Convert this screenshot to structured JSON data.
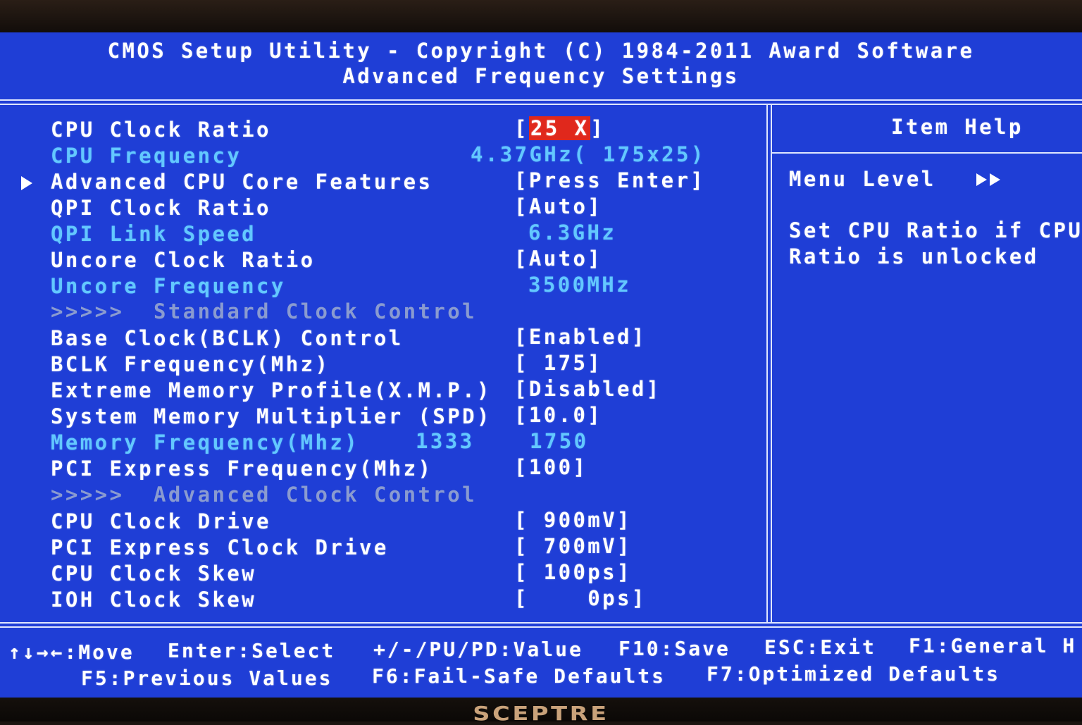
{
  "header": {
    "title": "CMOS Setup Utility - Copyright (C) 1984-2011 Award Software",
    "subtitle": "Advanced Frequency Settings"
  },
  "settings": [
    {
      "label": "CPU Clock Ratio",
      "value_open": "[",
      "value_selected": "25 X",
      "value_close": "]",
      "style": "normal"
    },
    {
      "label": "CPU Frequency",
      "value": "4.37GHz( 175x25)",
      "style": "info"
    },
    {
      "label": "Advanced CPU Core Features",
      "value": "[Press Enter]",
      "style": "normal",
      "submenu": true
    },
    {
      "label": "QPI Clock Ratio",
      "value": "[Auto]",
      "style": "normal"
    },
    {
      "label": "QPI Link Speed",
      "value": "6.3GHz",
      "style": "info"
    },
    {
      "label": "Uncore Clock Ratio",
      "value": "[Auto]",
      "style": "normal"
    },
    {
      "label": "Uncore Frequency",
      "value": "3500MHz",
      "style": "info"
    },
    {
      "label": ">>>>>  Standard Clock Control",
      "style": "section"
    },
    {
      "label": "Base Clock(BCLK) Control",
      "value": "[Enabled]",
      "style": "normal"
    },
    {
      "label": "BCLK Frequency(Mhz)",
      "value": "[ 175]",
      "style": "normal"
    },
    {
      "label": "Extreme Memory Profile(X.M.P.)",
      "value": "[Disabled]",
      "style": "normal"
    },
    {
      "label": "System Memory Multiplier (SPD)",
      "value": "[10.0]",
      "style": "normal"
    },
    {
      "label": "Memory Frequency(Mhz)",
      "extra": "1333",
      "value": "1750",
      "style": "info"
    },
    {
      "label": "PCI Express Frequency(Mhz)",
      "value": "[100]",
      "style": "normal"
    },
    {
      "label": ">>>>>  Advanced Clock Control",
      "style": "section"
    },
    {
      "label": "CPU Clock Drive",
      "value": "[ 900mV]",
      "style": "normal"
    },
    {
      "label": "PCI Express Clock Drive",
      "value": "[ 700mV]",
      "style": "normal"
    },
    {
      "label": "CPU Clock Skew",
      "value": "[ 100ps]",
      "style": "normal"
    },
    {
      "label": "IOH Clock Skew",
      "value": "[    0ps]",
      "style": "normal"
    }
  ],
  "help": {
    "title": "Item Help",
    "menu_level_label": "Menu Level",
    "text_line1": "Set CPU Ratio if CPU",
    "text_line2": "Ratio is unlocked"
  },
  "footer": {
    "move": "↑↓→←:Move",
    "select": "Enter:Select",
    "value": "+/-/PU/PD:Value",
    "save": "F10:Save",
    "exit": "ESC:Exit",
    "general_help": "F1:General H",
    "previous": "F5:Previous Values",
    "fail_safe": "F6:Fail-Safe Defaults",
    "optimized": "F7:Optimized Defaults"
  },
  "monitor": {
    "brand": "SCEPTRE"
  },
  "colors": {
    "background": "#1f3ed6",
    "text": "#ffffff",
    "info_text": "#63c8ff",
    "disabled_text": "#8a9bd0",
    "highlight": "#e0281c"
  }
}
